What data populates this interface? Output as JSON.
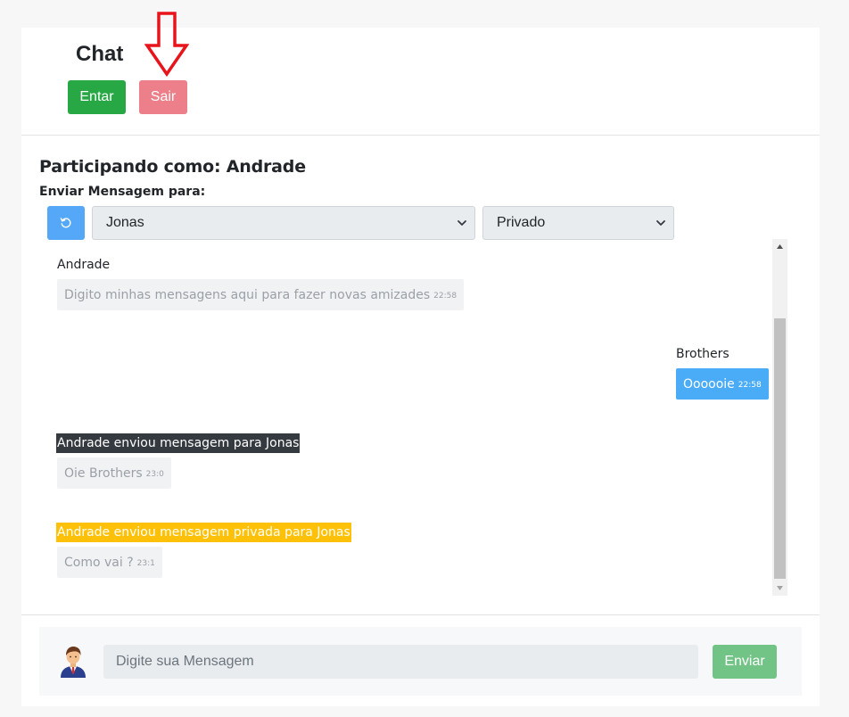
{
  "header": {
    "title": "Chat",
    "enter_label": "Entar",
    "exit_label": "Sair"
  },
  "session": {
    "participating_text": "Participando como: Andrade",
    "send_to_label": "Enviar Mensagem para:"
  },
  "controls": {
    "recipient_selected": "Jonas",
    "mode_selected": "Privado"
  },
  "messages": [
    {
      "author": "Andrade",
      "text": "Digito minhas mensagens aqui para fazer novas amizades",
      "time": "22:58"
    },
    {
      "author": "Brothers",
      "text": "Oooooie",
      "time": "22:58"
    },
    {
      "banner": "Andrade enviou mensagem para Jonas",
      "text": "Oie Brothers",
      "time": "23:0"
    },
    {
      "banner": "Andrade enviou mensagem privada para Jonas",
      "text": "Como vai ?",
      "time": "23:1"
    }
  ],
  "composer": {
    "placeholder": "Digite sua Mensagem",
    "send_label": "Enviar"
  },
  "colors": {
    "enter": "#28a745",
    "exit": "#ec7f89",
    "refresh": "#55a8f7",
    "own_bubble": "#4aabf7",
    "banner_dark": "#343a40",
    "banner_warning": "#ffc107",
    "send": "#72c486",
    "annotation_arrow": "#e8141c"
  },
  "icons": {
    "refresh": "refresh-icon",
    "annotation": "down-arrow-annotation-icon",
    "avatar": "user-avatar-icon"
  }
}
